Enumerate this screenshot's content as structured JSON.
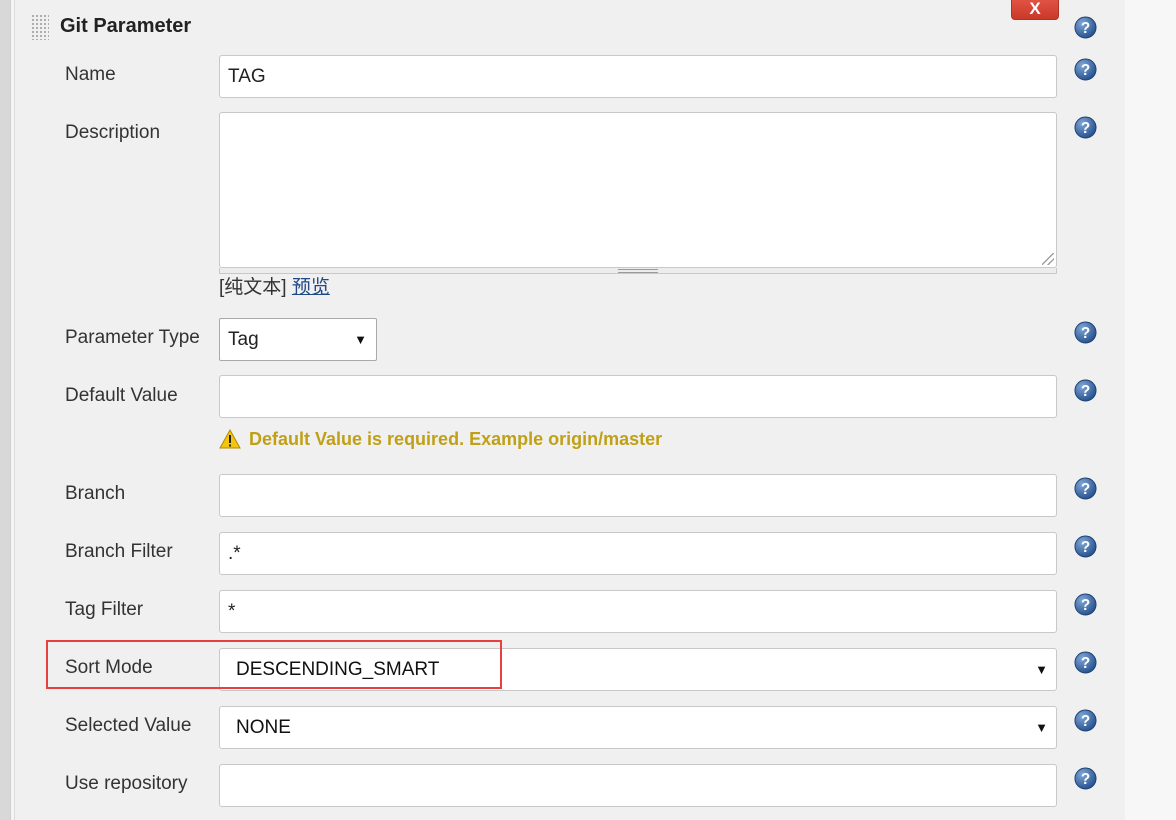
{
  "section": {
    "title": "Git Parameter",
    "delete_label": "X"
  },
  "fields": {
    "name": {
      "label": "Name",
      "value": "TAG"
    },
    "description": {
      "label": "Description",
      "value": ""
    },
    "markup": {
      "plain_text": "[纯文本]",
      "preview": "预览"
    },
    "parameter_type": {
      "label": "Parameter Type",
      "value": "Tag"
    },
    "default_value": {
      "label": "Default Value",
      "value": "",
      "warning": "Default Value is required. Example origin/master"
    },
    "branch": {
      "label": "Branch",
      "value": ""
    },
    "branch_filter": {
      "label": "Branch Filter",
      "value": ".*"
    },
    "tag_filter": {
      "label": "Tag Filter",
      "value": "*"
    },
    "sort_mode": {
      "label": "Sort Mode",
      "value": "DESCENDING_SMART"
    },
    "selected_value": {
      "label": "Selected Value",
      "value": "NONE"
    },
    "use_repository": {
      "label": "Use repository",
      "value": ""
    }
  },
  "icons": {
    "help": "help-icon",
    "warning": "warning-icon",
    "dropdown": "chevron-down-icon",
    "drag": "drag-handle-icon"
  },
  "colors": {
    "delete_button": "#d9483b",
    "warning_text": "#c0a016",
    "help_icon": "#2e5c96",
    "highlight": "#e8403e",
    "link": "#204a87"
  }
}
